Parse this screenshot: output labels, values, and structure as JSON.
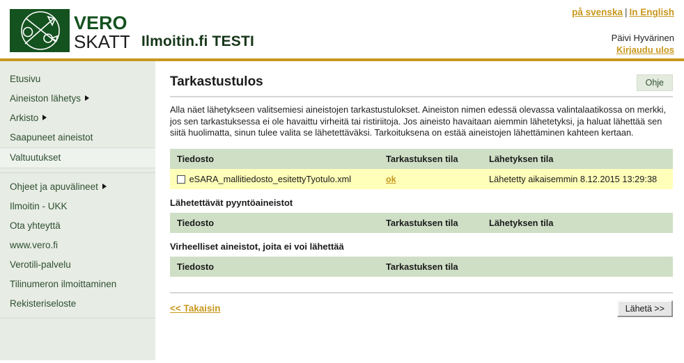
{
  "header": {
    "logo_primary": "VERO",
    "logo_secondary": "SKATT",
    "app_title": "Ilmoitin.fi TESTI",
    "lang_sv": "på svenska",
    "lang_separator": "|",
    "lang_en": "In English",
    "user_name": "Päivi Hyvärinen",
    "logout_label": "Kirjaudu ulos",
    "accent_color": "#c8981e",
    "logo_color": "#14521f"
  },
  "sidebar": {
    "items": [
      {
        "label": "Etusivu",
        "has_arrow": false,
        "selected": false
      },
      {
        "label": "Aineiston lähetys",
        "has_arrow": true,
        "selected": false
      },
      {
        "label": "Arkisto",
        "has_arrow": true,
        "selected": false
      },
      {
        "label": "Saapuneet aineistot",
        "has_arrow": false,
        "selected": false
      },
      {
        "label": "Valtuutukset",
        "has_arrow": false,
        "selected": true
      },
      {
        "label": "Ohjeet ja apuvälineet",
        "has_arrow": true,
        "selected": false
      },
      {
        "label": "Ilmoitin - UKK",
        "has_arrow": false,
        "selected": false
      },
      {
        "label": "Ota yhteyttä",
        "has_arrow": false,
        "selected": false
      },
      {
        "label": "www.vero.fi",
        "has_arrow": false,
        "selected": false
      },
      {
        "label": "Verotili-palvelu",
        "has_arrow": false,
        "selected": false
      },
      {
        "label": "Tilinumeron ilmoittaminen",
        "has_arrow": false,
        "selected": false
      },
      {
        "label": "Rekisteriseloste",
        "has_arrow": false,
        "selected": false
      }
    ]
  },
  "main": {
    "page_title": "Tarkastustulos",
    "help_button": "Ohje",
    "intro": "Alla näet lähetykseen valitsemiesi aineistojen tarkastustulokset. Aineiston nimen edessä olevassa valintalaatikossa on merkki, jos sen tarkastuksessa ei ole havaittu virheitä tai ristiriitoja. Jos aineisto havaitaan aiemmin lähetetyksi, ja haluat lähettää sen siitä huolimatta, sinun tulee valita se lähetettäväksi. Tarkoituksena on estää aineistojen lähettäminen kahteen kertaan.",
    "table_main": {
      "headers": {
        "file": "Tiedosto",
        "check_status": "Tarkastuksen tila",
        "send_status": "Lähetyksen tila"
      },
      "rows": [
        {
          "checked": false,
          "file_name": "eSARA_mallitiedosto_esitettyTyotulo.xml",
          "check_status": "ok",
          "send_status": "Lähetetty aikaisemmin 8.12.2015 13:29:38"
        }
      ]
    },
    "section_requests": {
      "title": "Lähetettävät pyyntöaineistot",
      "headers": {
        "file": "Tiedosto",
        "check_status": "Tarkastuksen tila",
        "send_status": "Lähetyksen tila"
      },
      "rows": []
    },
    "section_errors": {
      "title": "Virheelliset aineistot, joita ei voi lähettää",
      "headers": {
        "file": "Tiedosto",
        "check_status": "Tarkastuksen tila"
      },
      "rows": []
    },
    "footer": {
      "back_label": "<< Takaisin",
      "send_label": "Lähetä >>"
    }
  }
}
